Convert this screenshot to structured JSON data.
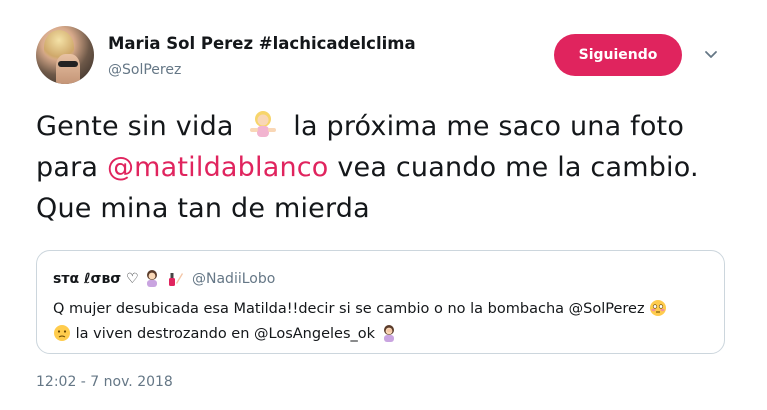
{
  "author": {
    "display_name": "Maria Sol Perez #lachicadelclima",
    "handle": "@SolPerez",
    "avatar_icon": "profile-photo"
  },
  "follow_button": {
    "label": "Siguiendo",
    "color": "#e0245e"
  },
  "menu_icon": "chevron-down-icon",
  "tweet": {
    "part1": "Gente sin vida",
    "emoji1": "woman-shrugging-emoji",
    "part2": "la próxima me saco una foto para",
    "mention": "@matildablanco",
    "part3": "vea cuando me la cambio. Que mina tan de mierda"
  },
  "quoted_tweet": {
    "name": "ѕтα ℓσвσ ♡",
    "name_emojis": [
      "woman-tipping-hand-emoji",
      "nail-polish-emoji"
    ],
    "handle": "@NadiiLobo",
    "line1": "Q mujer desubicada esa Matilda!!decir si se cambio o no la bombacha @SolPerez",
    "line1_emoji": "flushed-face-emoji",
    "line2_emoji": "confused-face-emoji",
    "line2": "la viven destrozando en @LosAngeles_ok",
    "line2_end_emoji": "woman-facepalming-emoji"
  },
  "timestamp": "12:02 - 7 nov. 2018"
}
